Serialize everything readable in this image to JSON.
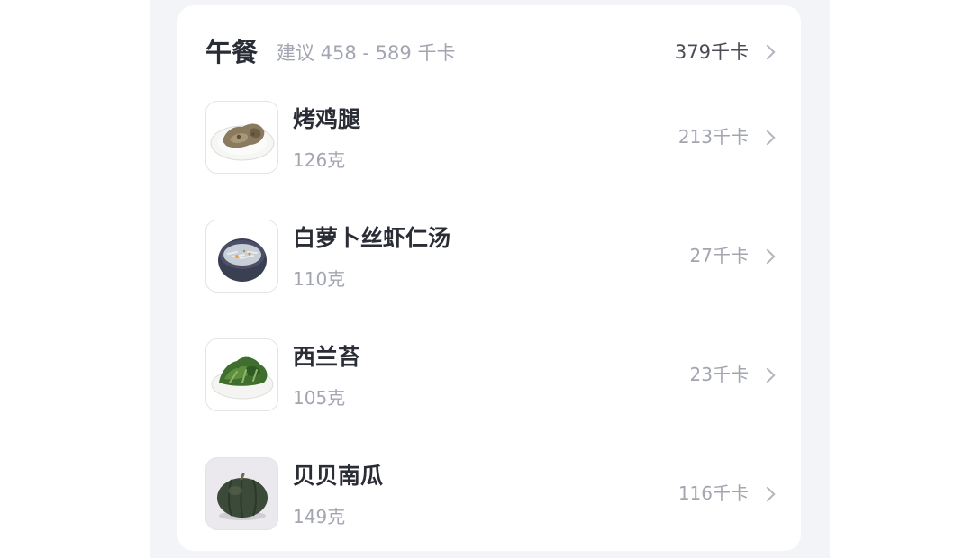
{
  "meal": {
    "title": "午餐",
    "suggestion": "建议 458 - 589 千卡",
    "total": "379千卡"
  },
  "foods": [
    {
      "name": "烤鸡腿",
      "weight": "126克",
      "kcal": "213千卡",
      "icon": "roast-chicken-leg-photo"
    },
    {
      "name": "白萝卜丝虾仁汤",
      "weight": "110克",
      "kcal": "27千卡",
      "icon": "radish-shrimp-soup-photo"
    },
    {
      "name": "西兰苔",
      "weight": "105克",
      "kcal": "23千卡",
      "icon": "broccolini-photo"
    },
    {
      "name": "贝贝南瓜",
      "weight": "149克",
      "kcal": "116千卡",
      "icon": "pumpkin-photo"
    }
  ],
  "colors": {
    "background_panel": "#f3f4f8",
    "card": "#ffffff",
    "title_text": "#2b2d36",
    "secondary_text": "#a3a6b0",
    "chevron": "#b4b6be"
  }
}
